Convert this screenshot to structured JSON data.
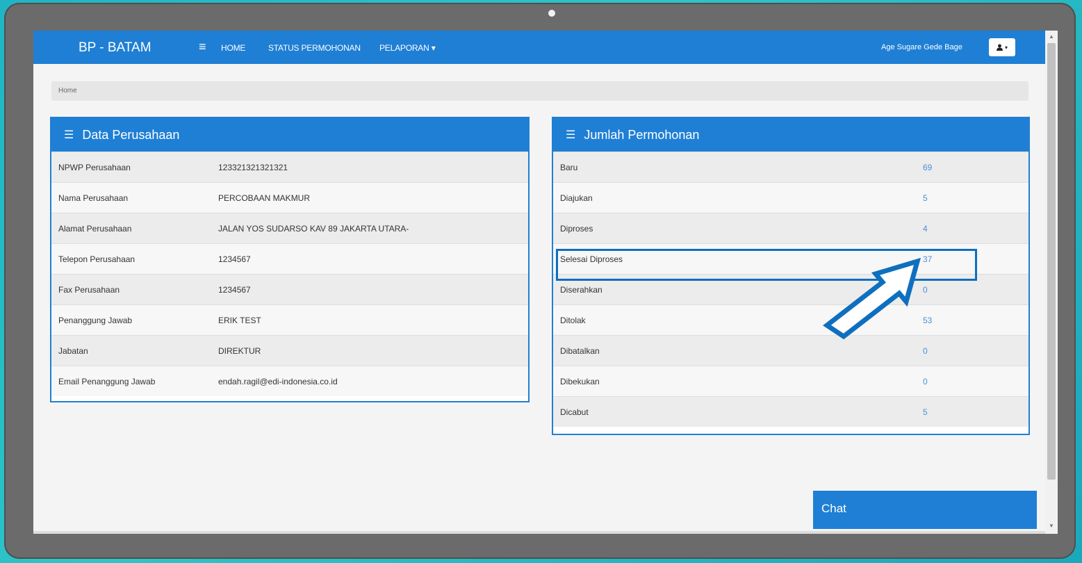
{
  "navbar": {
    "brand": "BP - BATAM",
    "links": [
      "HOME",
      "STATUS PERMOHONAN",
      "PELAPORAN ▾"
    ],
    "user_name": "Age Sugare Gede Bage"
  },
  "breadcrumb": "Home",
  "company_panel": {
    "title": "Data Perusahaan",
    "rows": [
      {
        "label": "NPWP Perusahaan",
        "value": "123321321321321"
      },
      {
        "label": "Nama Perusahaan",
        "value": "PERCOBAAN MAKMUR"
      },
      {
        "label": "Alamat Perusahaan",
        "value": "JALAN YOS SUDARSO KAV 89 JAKARTA UTARA-"
      },
      {
        "label": "Telepon Perusahaan",
        "value": "1234567"
      },
      {
        "label": "Fax Perusahaan",
        "value": "1234567"
      },
      {
        "label": "Penanggung Jawab",
        "value": "ERIK TEST"
      },
      {
        "label": "Jabatan",
        "value": "DIREKTUR"
      },
      {
        "label": "Email Penanggung Jawab",
        "value": "endah.ragil@edi-indonesia.co.id"
      }
    ]
  },
  "count_panel": {
    "title": "Jumlah Permohonan",
    "rows": [
      {
        "label": "Baru",
        "value": "69"
      },
      {
        "label": "Diajukan",
        "value": "5"
      },
      {
        "label": "Diproses",
        "value": "4"
      },
      {
        "label": "Selesai Diproses",
        "value": "37"
      },
      {
        "label": "Diserahkan",
        "value": "0"
      },
      {
        "label": "Ditolak",
        "value": "53"
      },
      {
        "label": "Dibatalkan",
        "value": "0"
      },
      {
        "label": "Dibekukan",
        "value": "0"
      },
      {
        "label": "Dicabut",
        "value": "5"
      }
    ]
  },
  "chat": {
    "label": "Chat"
  },
  "colors": {
    "primary": "#1f7fd4",
    "highlight": "#0f6fbf",
    "background": "#2ec4c9"
  },
  "icons": {
    "menu": "hamburger-icon",
    "panel": "list-icon",
    "user": "user-icon",
    "arrow": "pointer-arrow"
  }
}
